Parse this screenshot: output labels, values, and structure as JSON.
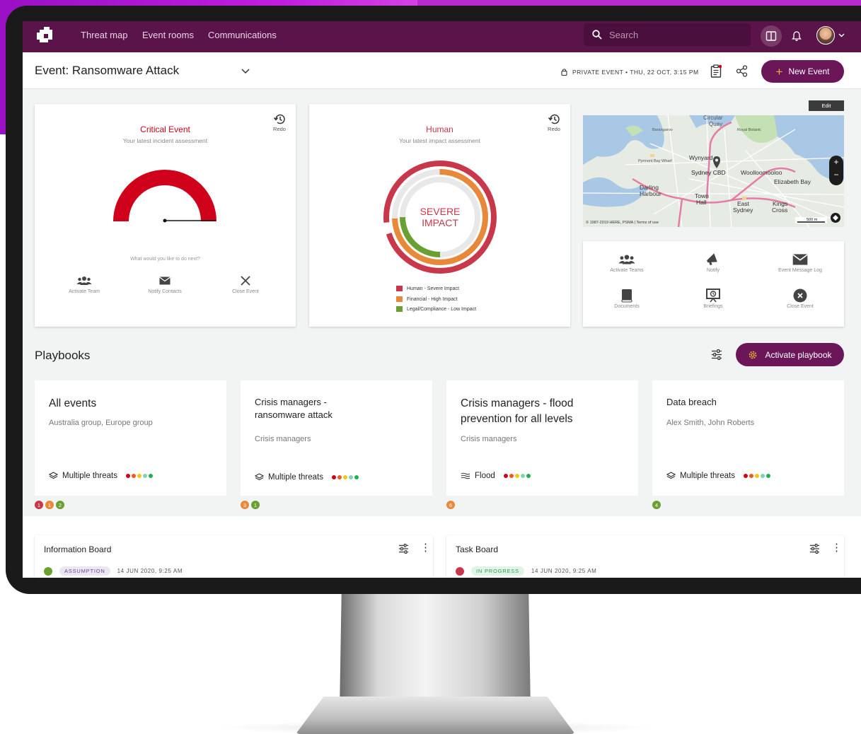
{
  "nav": {
    "links": [
      "Threat map",
      "Event rooms",
      "Communications"
    ],
    "search_placeholder": "Search"
  },
  "event": {
    "title": "Event: Ransomware Attack",
    "privacy": "PRIVATE EVENT • THU, 22 OCT, 3:15 PM",
    "new_event_label": "New Event"
  },
  "incident_card": {
    "title": "Critical Event",
    "subtitle": "Your latest incident assessment",
    "redo_label": "Redo",
    "prompt": "What would you like to do next?",
    "actions": [
      "Activate Team",
      "Notify Contacts",
      "Close Event"
    ],
    "gauge_level": 0.95
  },
  "impact_card": {
    "title": "Human",
    "subtitle": "Your latest impact assessment",
    "redo_label": "Redo",
    "center_line1": "SEVERE",
    "center_line2": "IMPACT",
    "legend": [
      {
        "label": "Human - Severe Impact",
        "color": "#c8374a"
      },
      {
        "label": "Financial - High Impact",
        "color": "#e8893a"
      },
      {
        "label": "Legal/Compliance - Low Impact",
        "color": "#6aa032"
      }
    ]
  },
  "map_card": {
    "edit_label": "Edit",
    "labels": [
      "Circular Quay",
      "Barangaroo",
      "Wynyard",
      "Sydney CBD",
      "Woolloomooloo",
      "Elizabeth Bay",
      "Darling Harbour",
      "Town Hall",
      "East Sydney",
      "Kings Cross",
      "Pyrmont",
      "Royal Botanic Gardens"
    ],
    "attribution": "© 1987-2019 HERE, PSMA | Terms of use",
    "scale": "500 m"
  },
  "quick_actions": [
    {
      "label": "Activate Teams",
      "icon": "team-icon"
    },
    {
      "label": "Notify",
      "icon": "megaphone-icon"
    },
    {
      "label": "Event Message Log",
      "icon": "envelope-icon"
    },
    {
      "label": "Documents",
      "icon": "book-icon"
    },
    {
      "label": "Briefings",
      "icon": "presentation-icon"
    },
    {
      "label": "Close Event",
      "icon": "close-circle-icon"
    }
  ],
  "playbooks": {
    "title": "Playbooks",
    "activate_label": "Activate playbook",
    "items": [
      {
        "name": "All events",
        "groups": "Australia group, Europe group",
        "threat": "Multiple threats",
        "badges": [
          "1",
          "1",
          "2"
        ]
      },
      {
        "name": "Crisis  managers - ransomware attack",
        "groups": "Crisis managers",
        "threat": "Multiple threats",
        "badges": [
          "3",
          "1"
        ]
      },
      {
        "name": "Crisis managers - flood prevention for all levels",
        "groups": "Crisis managers",
        "threat": "Flood",
        "badges": [
          "6"
        ]
      },
      {
        "name": "Data breach",
        "groups": "Alex Smith, John Roberts",
        "threat": "Multiple threats",
        "badges": [
          "4"
        ]
      }
    ]
  },
  "boards": [
    {
      "title": "Information Board",
      "status": "ASSUMPTION",
      "timestamp": "14 JUN 2020, 9:25 AM"
    },
    {
      "title": "Task Board",
      "status": "IN PROGRESS",
      "timestamp": "14 JUN 2020, 9:25 AM"
    }
  ],
  "colors": {
    "nav": "#5a1449",
    "accent": "#6b1659",
    "critical": "#d0021b"
  }
}
